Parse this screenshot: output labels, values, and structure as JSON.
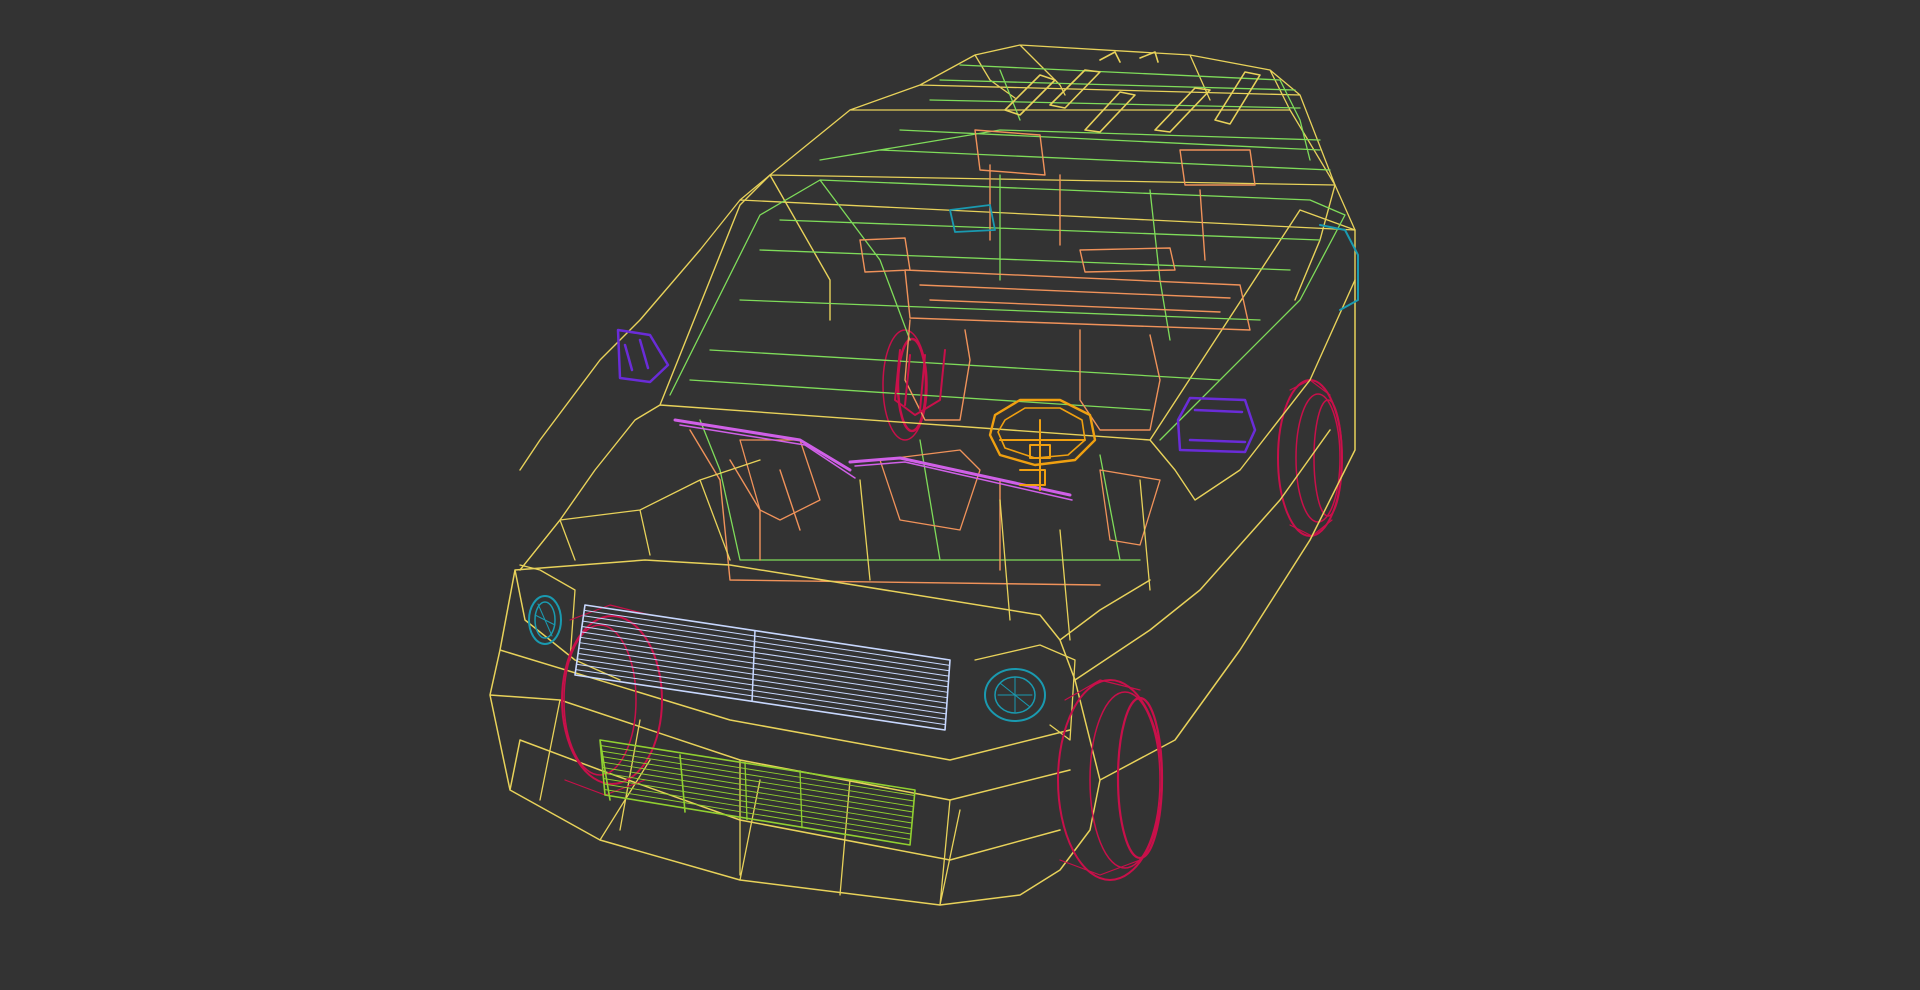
{
  "viewport": {
    "background": "#333333",
    "render_mode": "wireframe",
    "subject": "car-model"
  },
  "colors": {
    "body": "#e8d25a",
    "interior": "#7fdc5a",
    "seats": "#f0925a",
    "wheels": "#c8104a",
    "headlights": "#1a9ab0",
    "grille": "#c8d8ff",
    "mirrors": "#6a2cd8",
    "wipers": "#d060e8",
    "steering": "#f0a010",
    "fog_grille": "#90d030"
  }
}
